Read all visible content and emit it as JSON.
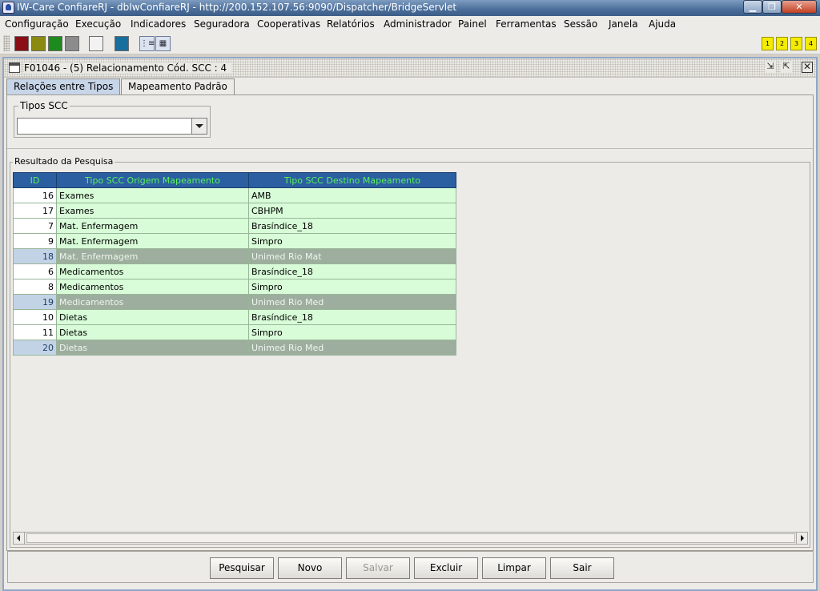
{
  "window": {
    "title": "IW-Care ConfiareRJ - dbIwConfiareRJ - http://200.152.107.56:9090/Dispatcher/BridgeServlet"
  },
  "menu": [
    "Configuração",
    "Execução",
    "Indicadores",
    "Seguradora",
    "Cooperativas",
    "Relatórios",
    "Administrador",
    "Painel",
    "Ferramentas",
    "Sessão",
    "Janela",
    "Ajuda"
  ],
  "toolbar": {
    "swatch_colors": [
      "#8a0e14",
      "#8a8a10",
      "#1c8a1c",
      "#8c8c8c",
      "#f2f2f2",
      "#176f9e"
    ],
    "icons": [
      "tree-view-icon",
      "calculator-icon"
    ],
    "numbered_buttons": [
      "1",
      "2",
      "3",
      "4"
    ]
  },
  "frame": {
    "title": "F01046 - (5) Relacionamento Cód. SCC : 4"
  },
  "tabs": [
    {
      "label": "Relações entre Tipos",
      "active": true
    },
    {
      "label": "Mapeamento Padrão",
      "active": false
    }
  ],
  "filter": {
    "group_label": "Tipos SCC",
    "selected_value": ""
  },
  "results": {
    "group_label": "Resultado da Pesquisa",
    "columns": [
      "ID",
      "Tipo SCC Origem Mapeamento",
      "Tipo SCC Destino Mapeamento"
    ],
    "rows": [
      {
        "id": "16",
        "origem": "Exames",
        "destino": "AMB",
        "highlighted": false
      },
      {
        "id": "17",
        "origem": "Exames",
        "destino": "CBHPM",
        "highlighted": false
      },
      {
        "id": "7",
        "origem": "Mat. Enfermagem",
        "destino": "Brasíndice_18",
        "highlighted": false
      },
      {
        "id": "9",
        "origem": "Mat. Enfermagem",
        "destino": "Simpro",
        "highlighted": false
      },
      {
        "id": "18",
        "origem": "Mat. Enfermagem",
        "destino": "Unimed Rio Mat",
        "highlighted": true
      },
      {
        "id": "6",
        "origem": "Medicamentos",
        "destino": "Brasíndice_18",
        "highlighted": false
      },
      {
        "id": "8",
        "origem": "Medicamentos",
        "destino": "Simpro",
        "highlighted": false
      },
      {
        "id": "19",
        "origem": "Medicamentos",
        "destino": "Unimed Rio Med",
        "highlighted": true
      },
      {
        "id": "10",
        "origem": "Dietas",
        "destino": "Brasíndice_18",
        "highlighted": false
      },
      {
        "id": "11",
        "origem": "Dietas",
        "destino": "Simpro",
        "highlighted": false
      },
      {
        "id": "20",
        "origem": "Dietas",
        "destino": "Unimed Rio Med",
        "highlighted": true
      }
    ]
  },
  "buttons": {
    "pesquisar": "Pesquisar",
    "novo": "Novo",
    "salvar": "Salvar",
    "excluir": "Excluir",
    "limpar": "Limpar",
    "sair": "Sair"
  }
}
